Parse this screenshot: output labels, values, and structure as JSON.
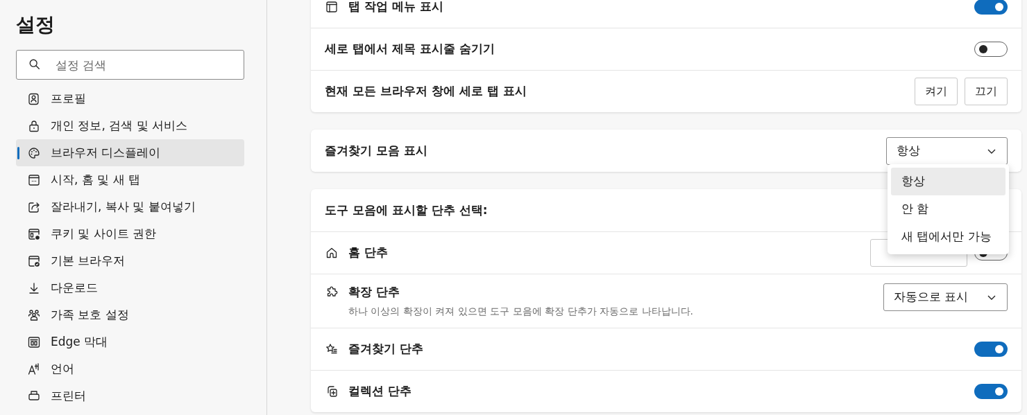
{
  "sidebar": {
    "title": "설정",
    "search": {
      "placeholder": "설정 검색"
    },
    "items": [
      {
        "label": "프로필",
        "selected": false
      },
      {
        "label": "개인 정보, 검색 및 서비스",
        "selected": false
      },
      {
        "label": "브라우저 디스플레이",
        "selected": true
      },
      {
        "label": "시작, 홈 및 새 탭",
        "selected": false
      },
      {
        "label": "잘라내기, 복사 및 붙여넣기",
        "selected": false
      },
      {
        "label": "쿠키 및 사이트 권한",
        "selected": false
      },
      {
        "label": "기본 브라우저",
        "selected": false
      },
      {
        "label": "다운로드",
        "selected": false
      },
      {
        "label": "가족 보호 설정",
        "selected": false
      },
      {
        "label": "Edge 막대",
        "selected": false
      },
      {
        "label": "언어",
        "selected": false
      },
      {
        "label": "프린터",
        "selected": false
      }
    ]
  },
  "cards": [
    {
      "rows": [
        {
          "kind": "toggle",
          "label": "탭 작업 메뉴 표시",
          "on": true
        },
        {
          "kind": "toggle",
          "label": "세로 탭에서 제목 표시줄 숨기기",
          "on": false
        },
        {
          "kind": "buttons",
          "label": "현재 모든 브라우저 창에 세로 탭 표시",
          "buttons": [
            "켜기",
            "끄기"
          ]
        }
      ]
    },
    {
      "rows": [
        {
          "kind": "select",
          "label": "즐겨찾기 모음 표시",
          "value": "항상"
        }
      ]
    },
    {
      "header": "도구 모음에 표시할 단추 선택:",
      "rows": [
        {
          "kind": "button_toggle",
          "label": "홈 단추",
          "on": false
        },
        {
          "kind": "select",
          "label": "확장 단추",
          "description": "하나 이상의 확장이 켜져 있으면 도구 모음에 확장 단추가 자동으로 나타납니다.",
          "value": "자동으로 표시"
        },
        {
          "kind": "toggle",
          "label": "즐겨찾기 단추",
          "on": true
        },
        {
          "kind": "toggle",
          "label": "컬렉션 단추",
          "on": true
        }
      ]
    }
  ],
  "dropdown": {
    "options": [
      {
        "label": "항상",
        "selected": true
      },
      {
        "label": "안 함",
        "selected": false
      },
      {
        "label": "새 탭에서만 가능",
        "selected": false
      }
    ]
  }
}
